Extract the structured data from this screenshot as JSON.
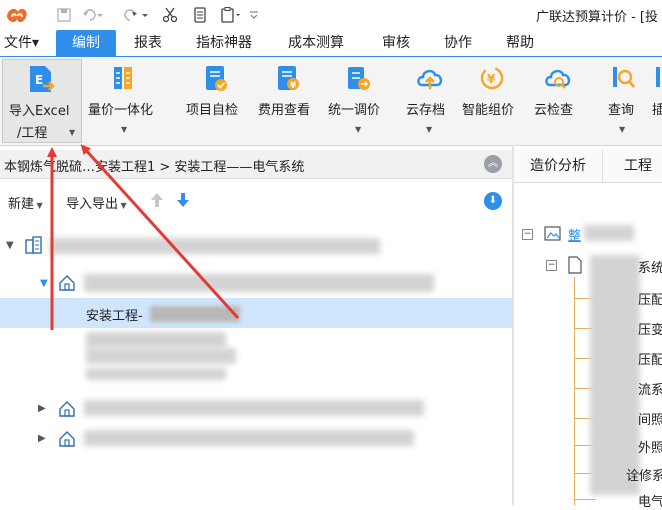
{
  "window": {
    "title": "广联达预算计价 - [投"
  },
  "quick_access": {
    "undo_icon": "undo-icon",
    "redo_icon": "redo-icon"
  },
  "menu": {
    "items": [
      "文件▾",
      "编制",
      "报表",
      "指标神器",
      "成本测算",
      "审核",
      "协作",
      "帮助"
    ],
    "active_index": 1,
    "accent_color": "#2f8ee9"
  },
  "ribbon": {
    "buttons": [
      {
        "label_line1": "导入Excel",
        "label_line2": "/工程",
        "icon": "import-excel-icon",
        "has_caret": true,
        "selected": true
      },
      {
        "label_line1": "量价一体化",
        "icon": "price-integration-icon",
        "has_caret": true
      },
      {
        "label_line1": "项目自检",
        "icon": "self-check-icon"
      },
      {
        "label_line1": "费用查看",
        "icon": "cost-view-icon"
      },
      {
        "label_line1": "统一调价",
        "icon": "unified-pricing-icon",
        "has_caret": true
      },
      {
        "label_line1": "云存档",
        "icon": "cloud-archive-icon",
        "has_caret": true
      },
      {
        "label_line1": "智能组价",
        "icon": "smart-pricing-icon"
      },
      {
        "label_line1": "云检查",
        "icon": "cloud-check-icon"
      },
      {
        "label_line1": "查询",
        "icon": "query-icon",
        "has_caret": true
      },
      {
        "label_line1": "插",
        "icon": "insert-icon"
      }
    ]
  },
  "breadcrumb": {
    "text": "本钢炼气脱硫…安装工程1 > 安装工程——电气系统"
  },
  "left_toolbar": {
    "new_label": "新建",
    "import_export_label": "导入导出"
  },
  "tree": {
    "selected_label": "安装工程-"
  },
  "right_panel": {
    "tabs": [
      "造价分析",
      "工程"
    ],
    "root_label": "整",
    "fragments": [
      "系统",
      "压配",
      "压变",
      "压配",
      "流系",
      "间照",
      "外照",
      "诠修系",
      "电气"
    ]
  },
  "colors": {
    "accent": "#2f8ee9",
    "arrow": "#e53935",
    "selection": "#cfe5fb"
  }
}
